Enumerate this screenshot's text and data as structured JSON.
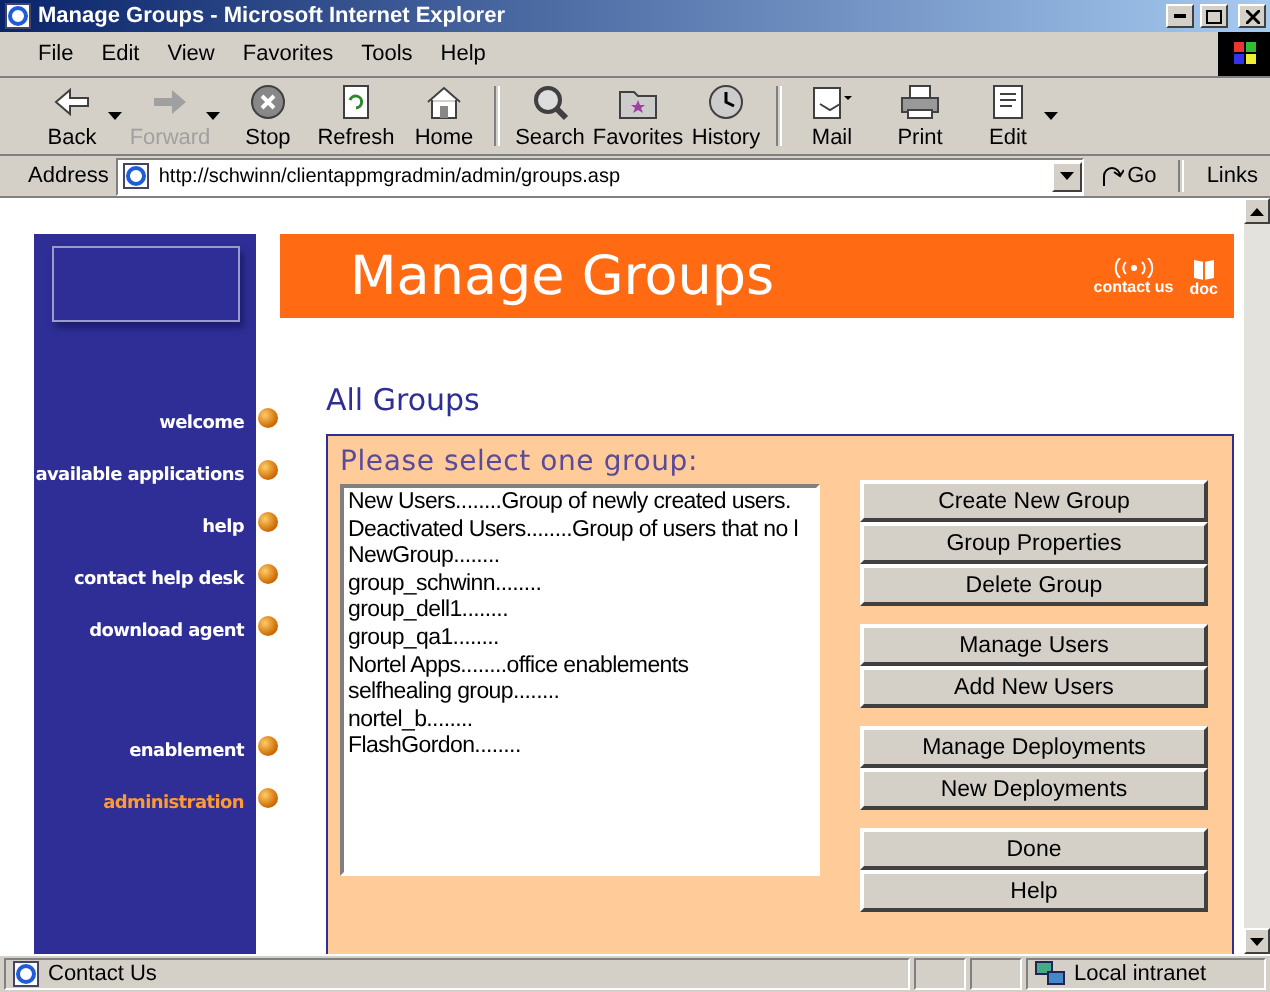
{
  "window": {
    "title": "Manage Groups - Microsoft Internet Explorer"
  },
  "menu": [
    "File",
    "Edit",
    "View",
    "Favorites",
    "Tools",
    "Help"
  ],
  "toolbar": [
    {
      "kind": "back",
      "label": "Back",
      "disabled": false,
      "dropdown": true
    },
    {
      "kind": "forward",
      "label": "Forward",
      "disabled": true,
      "dropdown": true
    },
    {
      "kind": "stop",
      "label": "Stop",
      "disabled": false,
      "dropdown": false
    },
    {
      "kind": "refresh",
      "label": "Refresh",
      "disabled": false,
      "dropdown": false
    },
    {
      "kind": "home",
      "label": "Home",
      "disabled": false,
      "dropdown": false
    },
    {
      "kind": "search",
      "label": "Search",
      "disabled": false,
      "dropdown": false
    },
    {
      "kind": "favorites",
      "label": "Favorites",
      "disabled": false,
      "dropdown": false
    },
    {
      "kind": "history",
      "label": "History",
      "disabled": false,
      "dropdown": false
    },
    {
      "kind": "mail",
      "label": "Mail",
      "disabled": false,
      "dropdown": false
    },
    {
      "kind": "print",
      "label": "Print",
      "disabled": false,
      "dropdown": false
    },
    {
      "kind": "edit",
      "label": "Edit",
      "disabled": false,
      "dropdown": true
    }
  ],
  "address": {
    "label": "Address",
    "url": "http://schwinn/clientappmgradmin/admin/groups.asp",
    "go": "Go",
    "links": "Links"
  },
  "header": {
    "title": "Manage Groups",
    "links": [
      {
        "kind": "contact",
        "label": "contact us"
      },
      {
        "kind": "doc",
        "label": "doc"
      }
    ]
  },
  "sidebar": {
    "items": [
      {
        "label": "welcome",
        "selected": false
      },
      {
        "label": "available applications",
        "selected": false
      },
      {
        "label": "help",
        "selected": false
      },
      {
        "label": "contact help desk",
        "selected": false
      },
      {
        "label": "download agent",
        "selected": false
      },
      {
        "label": "enablement",
        "selected": false
      },
      {
        "label": "administration",
        "selected": true
      }
    ]
  },
  "section_title": "All Groups",
  "group_box": {
    "prompt": "Please select one group:",
    "groups": [
      "New Users........Group of newly created users.",
      "Deactivated Users........Group of users that no l",
      "NewGroup........",
      "group_schwinn........",
      "group_dell1........",
      "group_qa1........",
      "Nortel Apps........office enablements",
      "selfhealing group........",
      "nortel_b........",
      "FlashGordon........"
    ],
    "button_groups": [
      [
        "Create New Group",
        "Group Properties",
        "Delete Group"
      ],
      [
        "Manage Users",
        "Add New Users"
      ],
      [
        "Manage Deployments",
        "New Deployments"
      ],
      [
        "Done",
        "Help"
      ]
    ]
  },
  "status_bar": {
    "text": "Contact Us",
    "zone": "Local intranet"
  }
}
